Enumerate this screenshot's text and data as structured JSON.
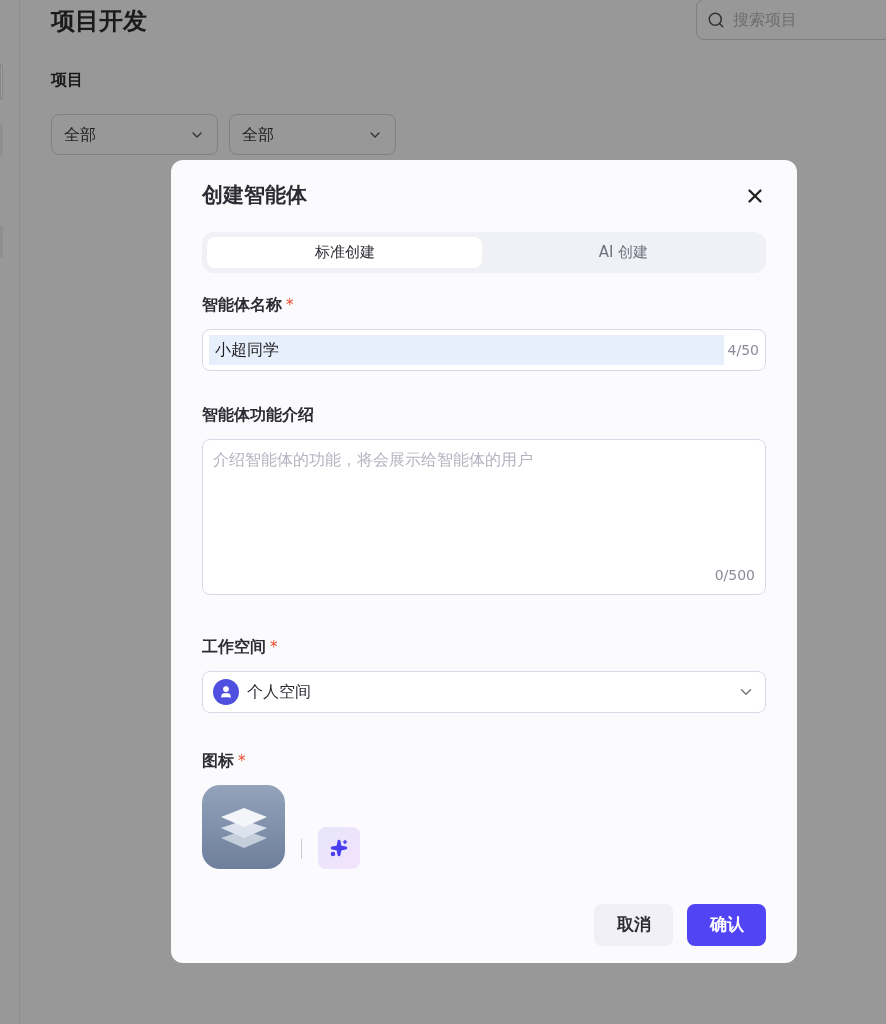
{
  "page": {
    "title": "项目开发",
    "search": {
      "placeholder": "搜索项目"
    },
    "filter_label": "项目",
    "filters": [
      {
        "value": "全部"
      },
      {
        "value": "全部"
      }
    ]
  },
  "dialog": {
    "title": "创建智能体",
    "tabs": [
      {
        "label": "标准创建",
        "selected": true
      },
      {
        "label": "AI 创建",
        "selected": false
      }
    ],
    "fields": [
      {
        "kind": "text",
        "label": "智能体名称",
        "required_mark": "*",
        "value": "小超同学",
        "count": "4/50"
      },
      {
        "kind": "textarea",
        "label": "智能体功能介绍",
        "placeholder": "介绍智能体的功能，将会展示给智能体的用户",
        "count": "0/500"
      },
      {
        "kind": "select",
        "label": "工作空间",
        "required_mark": "*",
        "value": "个人空间"
      },
      {
        "kind": "icon",
        "label": "图标",
        "required_mark": "*"
      }
    ],
    "buttons": [
      {
        "label": "取消",
        "primary": false
      },
      {
        "label": "确认",
        "primary": true
      }
    ]
  }
}
